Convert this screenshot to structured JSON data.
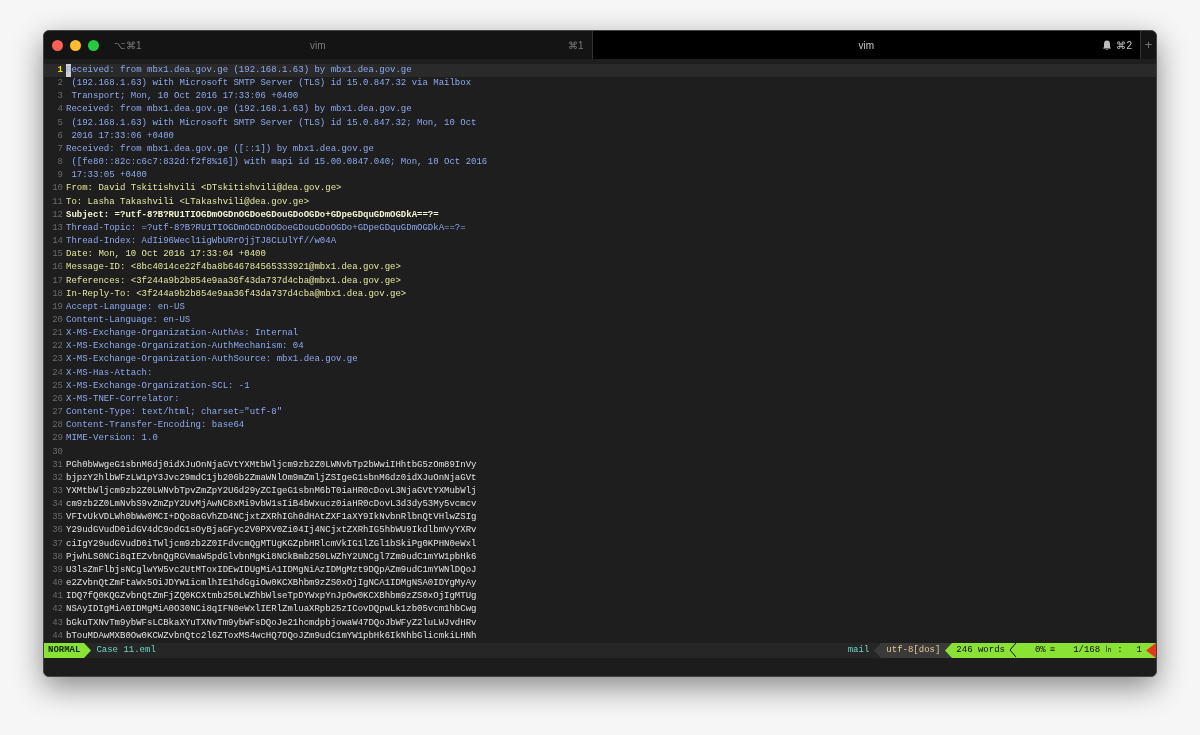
{
  "tabs": [
    {
      "shortcut_left": "⌥⌘1",
      "title": "vim",
      "shortcut": "⌘1",
      "selected": false,
      "bell": false
    },
    {
      "title": "vim",
      "shortcut": "⌘2",
      "selected": true,
      "bell": true
    }
  ],
  "new_tab": "+",
  "lines": [
    {
      "number": "1",
      "text": "Received: from mbx1.dea.gov.ge (192.168.1.63) by mbx1.dea.gov.ge",
      "kind": "header",
      "selected": true
    },
    {
      "number": "2",
      "text": " (192.168.1.63) with Microsoft SMTP Server (TLS) id 15.0.847.32 via Mailbox",
      "kind": "header",
      "selected": false
    },
    {
      "number": "3",
      "text": " Transport; Mon, 10 Oct 2016 17:33:06 +0400",
      "kind": "header",
      "selected": false
    },
    {
      "number": "4",
      "text": "Received: from mbx1.dea.gov.ge (192.168.1.63) by mbx1.dea.gov.ge",
      "kind": "header",
      "selected": false
    },
    {
      "number": "5",
      "text": " (192.168.1.63) with Microsoft SMTP Server (TLS) id 15.0.847.32; Mon, 10 Oct",
      "kind": "header",
      "selected": false
    },
    {
      "number": "6",
      "text": " 2016 17:33:06 +0400",
      "kind": "header",
      "selected": false
    },
    {
      "number": "7",
      "text": "Received: from mbx1.dea.gov.ge ([::1]) by mbx1.dea.gov.ge",
      "kind": "header",
      "selected": false
    },
    {
      "number": "8",
      "text": " ([fe80::82c:c6c7:832d:f2f8%16]) with mapi id 15.00.0847.040; Mon, 10 Oct 2016",
      "kind": "header",
      "selected": false
    },
    {
      "number": "9",
      "text": " 17:33:05 +0400",
      "kind": "header",
      "selected": false
    },
    {
      "number": "10",
      "text": "From: David Tskitishvili <DTskitishvili@dea.gov.ge>",
      "kind": "address",
      "selected": false
    },
    {
      "number": "11",
      "text": "To: Lasha Takashvili <LTakashvili@dea.gov.ge>",
      "kind": "address",
      "selected": false
    },
    {
      "number": "12",
      "text": "Subject: =?utf-8?B?RU1TIOGDmOGDnOGDoeGDouGDoOGDo+GDpeGDquGDmOGDkA==?=",
      "kind": "subject",
      "selected": false
    },
    {
      "number": "13",
      "text": "Thread-Topic: =?utf-8?B?RU1TIOGDmOGDnOGDoeGDouGDoOGDo+GDpeGDquGDmOGDkA==?=",
      "kind": "header",
      "selected": false
    },
    {
      "number": "14",
      "text": "Thread-Index: AdIi96Wecl1igWbURrOjjTJ8CLUlYf//w04A",
      "kind": "header",
      "selected": false
    },
    {
      "number": "15",
      "text": "Date: Mon, 10 Oct 2016 17:33:04 +0400",
      "kind": "address",
      "selected": false
    },
    {
      "number": "16",
      "text": "Message-ID: <8bc4014ce22f4ba8b646784565333921@mbx1.dea.gov.ge>",
      "kind": "address",
      "selected": false
    },
    {
      "number": "17",
      "text": "References: <3f244a9b2b854e9aa36f43da737d4cba@mbx1.dea.gov.ge>",
      "kind": "address",
      "selected": false
    },
    {
      "number": "18",
      "text": "In-Reply-To: <3f244a9b2b854e9aa36f43da737d4cba@mbx1.dea.gov.ge>",
      "kind": "address",
      "selected": false
    },
    {
      "number": "19",
      "text": "Accept-Language: en-US",
      "kind": "header",
      "selected": false
    },
    {
      "number": "20",
      "text": "Content-Language: en-US",
      "kind": "header",
      "selected": false
    },
    {
      "number": "21",
      "text": "X-MS-Exchange-Organization-AuthAs: Internal",
      "kind": "header",
      "selected": false
    },
    {
      "number": "22",
      "text": "X-MS-Exchange-Organization-AuthMechanism: 04",
      "kind": "header",
      "selected": false
    },
    {
      "number": "23",
      "text": "X-MS-Exchange-Organization-AuthSource: mbx1.dea.gov.ge",
      "kind": "header",
      "selected": false
    },
    {
      "number": "24",
      "text": "X-MS-Has-Attach:",
      "kind": "header",
      "selected": false
    },
    {
      "number": "25",
      "text": "X-MS-Exchange-Organization-SCL: -1",
      "kind": "header",
      "selected": false
    },
    {
      "number": "26",
      "text": "X-MS-TNEF-Correlator:",
      "kind": "header",
      "selected": false
    },
    {
      "number": "27",
      "text": "Content-Type: text/html; charset=\"utf-8\"",
      "kind": "header",
      "selected": false
    },
    {
      "number": "28",
      "text": "Content-Transfer-Encoding: base64",
      "kind": "header",
      "selected": false
    },
    {
      "number": "29",
      "text": "MIME-Version: 1.0",
      "kind": "header",
      "selected": false
    },
    {
      "number": "30",
      "kind": "blank",
      "selected": false
    },
    {
      "number": "31",
      "text": "PGh0bWwgeG1sbnM6dj0idXJuOnNjaGVtYXMtbWljcm9zb2Z0LWNvbTp2bWwiIHhtbG5zOm89InVy",
      "kind": "body",
      "selected": false
    },
    {
      "number": "32",
      "text": "bjpzY2hlbWFzLW1pY3Jvc29mdC1jb206b2ZmaWNlOm9mZmljZSIgeG1sbnM6dz0idXJuOnNjaGVt",
      "kind": "body",
      "selected": false
    },
    {
      "number": "33",
      "text": "YXMtbWljcm9zb2Z0LWNvbTpvZmZpY2U6d29yZCIgeG1sbnM6bT0iaHR0cDovL3NjaGVtYXMubWlj",
      "kind": "body",
      "selected": false
    },
    {
      "number": "34",
      "text": "cm9zb2Z0LmNvbS9vZmZpY2UvMjAwNC8xMi9vbW1sIiB4bWxucz0iaHR0cDovL3d3dy53My5vcmcv",
      "kind": "body",
      "selected": false
    },
    {
      "number": "35",
      "text": "VFIvUkVDLWh0bWw0MCI+DQo8aGVhZD4NCjxtZXRhIGh0dHAtZXF1aXY9IkNvbnRlbnQtVHlwZSIg",
      "kind": "body",
      "selected": false
    },
    {
      "number": "36",
      "text": "Y29udGVudD0idGV4dC9odG1sOyBjaGFyc2V0PXV0Zi04Ij4NCjxtZXRhIG5hbWU9IkdlbmVyYXRv",
      "kind": "body",
      "selected": false
    },
    {
      "number": "37",
      "text": "ciIgY29udGVudD0iTWljcm9zb2Z0IFdvcmQgMTUgKGZpbHRlcmVkIG1lZGl1bSkiPg0KPHN0eWxl",
      "kind": "body",
      "selected": false
    },
    {
      "number": "38",
      "text": "PjwhLS0NCi8qIEZvbnQgRGVmaW5pdGlvbnMgKi8NCkBmb250LWZhY2UNCgl7Zm9udC1mYW1pbHk6",
      "kind": "body",
      "selected": false
    },
    {
      "number": "39",
      "text": "U3lsZmFlbjsNCglwYW5vc2UtMToxIDEwIDUgMiA1IDMgNiAzIDMgMzt9DQpAZm9udC1mYWNlDQoJ",
      "kind": "body",
      "selected": false
    },
    {
      "number": "40",
      "text": "e2ZvbnQtZmFtaWx5OiJDYW1icmlhIE1hdGgiOw0KCXBhbm9zZS0xOjIgNCA1IDMgNSA0IDYgMyAy",
      "kind": "body",
      "selected": false
    },
    {
      "number": "41",
      "text": "IDQ7fQ0KQGZvbnQtZmFjZQ0KCXtmb250LWZhbWlseTpDYWxpYnJpOw0KCXBhbm9zZS0xOjIgMTUg",
      "kind": "body",
      "selected": false
    },
    {
      "number": "42",
      "text": "NSAyIDIgMiA0IDMgMiA0O30NCi8qIFN0eWxlIERlZmluaXRpb25zICovDQpwLk1zb05vcm1hbCwg",
      "kind": "body",
      "selected": false
    },
    {
      "number": "43",
      "text": "bGkuTXNvTm9ybWFsLCBkaXYuTXNvTm9ybWFsDQoJe21hcmdpbjowaW47DQoJbWFyZ2luLWJvdHRv",
      "kind": "body",
      "selected": false
    },
    {
      "number": "44",
      "text": "bTouMDAwMXB0Ow0KCWZvbnQtc2l6ZToxMS4wcHQ7DQoJZm9udC1mYW1pbHk6IkNhbGlicmkiLHNh",
      "kind": "body",
      "selected": false
    }
  ],
  "status_bar": {
    "mode": "NORMAL",
    "file": "Case 11.eml",
    "filetype": "mail",
    "encoding": "utf-8[dos]",
    "words": "246 words",
    "percent": "0%",
    "percent_glyph": "≡",
    "position": "1/168",
    "line_glyph": "㏑",
    "separator": ":",
    "column": "1"
  }
}
